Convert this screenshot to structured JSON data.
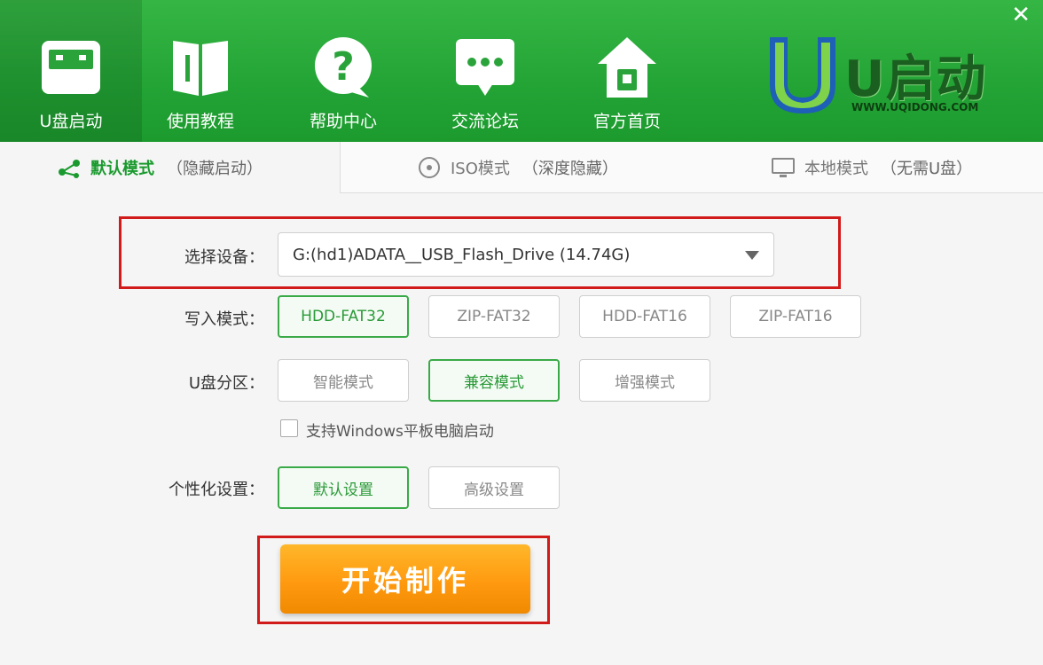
{
  "nav": [
    {
      "label": "U盘启动",
      "icon": "usb-drive-icon"
    },
    {
      "label": "使用教程",
      "icon": "book-icon"
    },
    {
      "label": "帮助中心",
      "icon": "help-icon"
    },
    {
      "label": "交流论坛",
      "icon": "chat-bubble-icon"
    },
    {
      "label": "官方首页",
      "icon": "home-icon"
    }
  ],
  "logo": {
    "text": "U启动",
    "url": "WWW.UQIDONG.COM"
  },
  "close_label": "✕",
  "tabs": [
    {
      "main": "默认模式",
      "sub": "（隐藏启动）",
      "icon": "share-icon"
    },
    {
      "main": "ISO模式",
      "sub": "（深度隐藏）",
      "icon": "disc-icon"
    },
    {
      "main": "本地模式",
      "sub": "（无需U盘）",
      "icon": "monitor-icon"
    }
  ],
  "form": {
    "device_label": "选择设备：",
    "device_value": "G:(hd1)ADATA__USB_Flash_Drive (14.74G)",
    "write_mode_label": "写入模式：",
    "write_modes": [
      "HDD-FAT32",
      "ZIP-FAT32",
      "HDD-FAT16",
      "ZIP-FAT16"
    ],
    "partition_label": "U盘分区：",
    "partitions": [
      "智能模式",
      "兼容模式",
      "增强模式"
    ],
    "tablet_checkbox": "支持Windows平板电脑启动",
    "personalize_label": "个性化设置：",
    "personalize": [
      "默认设置",
      "高级设置"
    ],
    "start_button": "开始制作"
  },
  "colors": {
    "header": "#23a435",
    "accent": "#2a9a38",
    "highlight": "#d11a1a",
    "start": "#ff9a10"
  }
}
